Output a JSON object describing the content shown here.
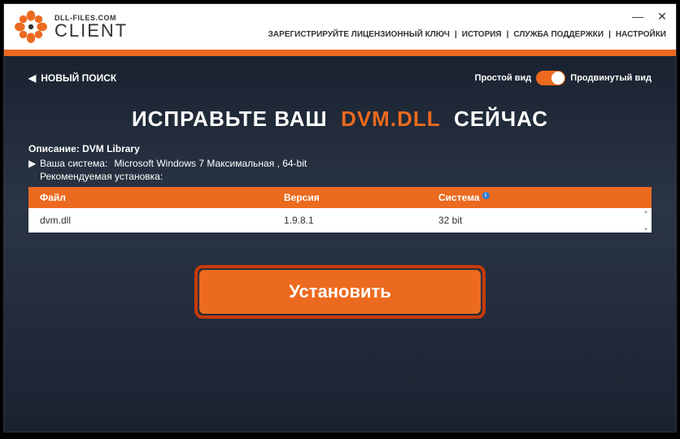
{
  "app": {
    "brand_top": "DLL-FILES.COM",
    "brand_bottom": "CLIENT"
  },
  "nav": {
    "register": "ЗАРЕГИСТРИРУЙТЕ ЛИЦЕНЗИОННЫЙ КЛЮЧ",
    "history": "ИСТОРИЯ",
    "support": "СЛУЖБА ПОДДЕРЖКИ",
    "settings": "НАСТРОЙКИ",
    "sep": "|"
  },
  "window_controls": {
    "minimize": "—",
    "close": "✕"
  },
  "top": {
    "new_search": "НОВЫЙ ПОИСК",
    "simple_view": "Простой вид",
    "advanced_view": "Продвинутый вид"
  },
  "headline": {
    "pre": "ИСПРАВЬТЕ ВАШ",
    "file": "DVM.DLL",
    "post": "СЕЙЧАС"
  },
  "description": {
    "label": "Описание:",
    "text": "DVM Library"
  },
  "system": {
    "label": "Ваша система:",
    "text": "Microsoft Windows 7 Максимальная , 64-bit"
  },
  "recommended": "Рекомендуемая установка:",
  "table": {
    "headers": {
      "file": "Файл",
      "version": "Версия",
      "system": "Система"
    },
    "rows": [
      {
        "file": "dvm.dll",
        "version": "1.9.8.1",
        "system": "32 bit"
      }
    ]
  },
  "install_button": "Установить",
  "colors": {
    "accent": "#ec6a1f"
  }
}
